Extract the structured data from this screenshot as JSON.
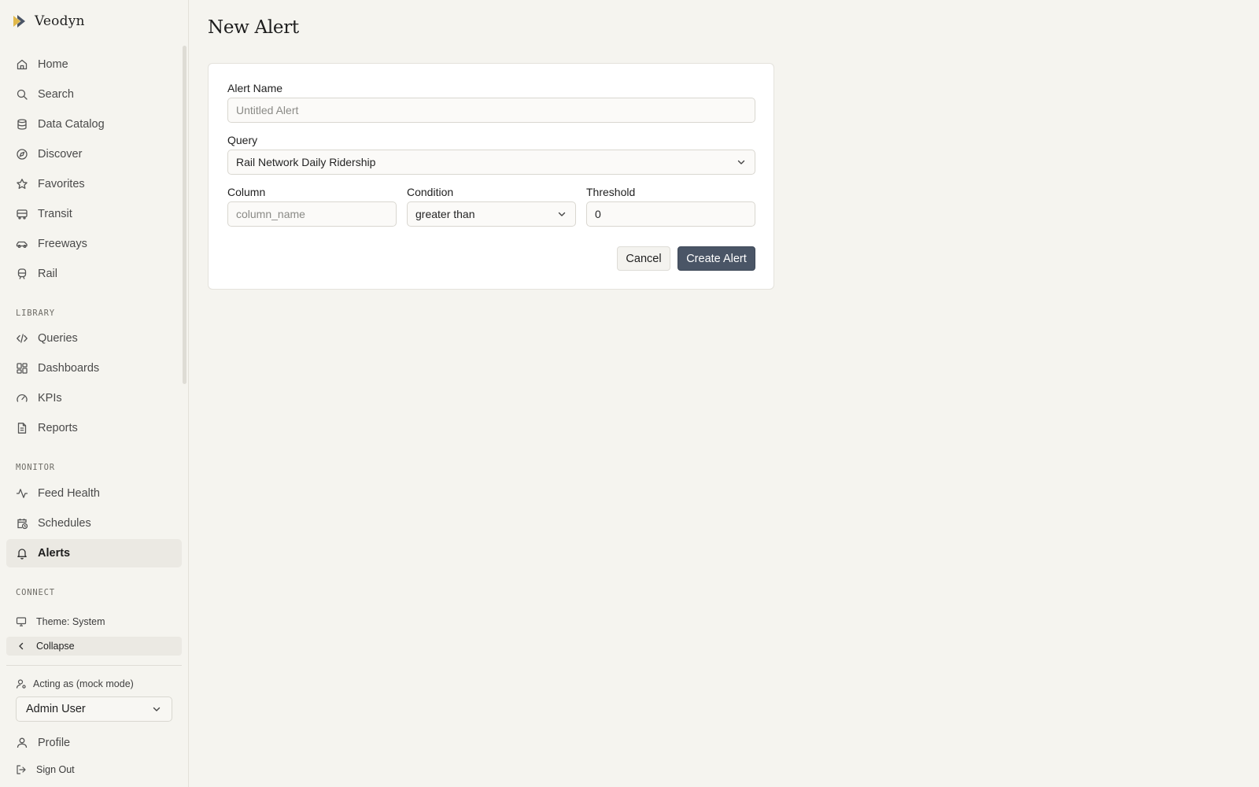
{
  "app": {
    "name": "Veodyn"
  },
  "sidebar": {
    "main_items": [
      {
        "label": "Home",
        "icon": "home-icon"
      },
      {
        "label": "Search",
        "icon": "search-icon"
      },
      {
        "label": "Data Catalog",
        "icon": "database-icon"
      },
      {
        "label": "Discover",
        "icon": "compass-icon"
      },
      {
        "label": "Favorites",
        "icon": "star-icon"
      },
      {
        "label": "Transit",
        "icon": "bus-icon"
      },
      {
        "label": "Freeways",
        "icon": "car-icon"
      },
      {
        "label": "Rail",
        "icon": "train-icon"
      }
    ],
    "library": {
      "label": "LIBRARY",
      "items": [
        {
          "label": "Queries",
          "icon": "code-icon"
        },
        {
          "label": "Dashboards",
          "icon": "dashboard-icon"
        },
        {
          "label": "KPIs",
          "icon": "gauge-icon"
        },
        {
          "label": "Reports",
          "icon": "report-icon"
        }
      ]
    },
    "monitor": {
      "label": "MONITOR",
      "items": [
        {
          "label": "Feed Health",
          "icon": "activity-icon"
        },
        {
          "label": "Schedules",
          "icon": "calendar-clock-icon"
        },
        {
          "label": "Alerts",
          "icon": "bell-icon",
          "active": true
        }
      ]
    },
    "connect": {
      "label": "CONNECT",
      "theme_label": "Theme: System",
      "collapse_label": "Collapse"
    },
    "acting_as_label": "Acting as (mock mode)",
    "acting_user": "Admin User",
    "profile_label": "Profile",
    "signout_label": "Sign Out"
  },
  "page": {
    "title": "New Alert",
    "form": {
      "alert_name": {
        "label": "Alert Name",
        "placeholder": "Untitled Alert",
        "value": ""
      },
      "query": {
        "label": "Query",
        "value": "Rail Network Daily Ridership"
      },
      "column": {
        "label": "Column",
        "placeholder": "column_name",
        "value": ""
      },
      "condition": {
        "label": "Condition",
        "value": "greater than"
      },
      "threshold": {
        "label": "Threshold",
        "value": "0"
      }
    },
    "buttons": {
      "cancel": "Cancel",
      "create": "Create Alert"
    }
  },
  "colors": {
    "background": "#f5f4ef",
    "primary_button": "#4a5566",
    "active_nav": "#ebe9e3",
    "logo_accent": "#e0b84a"
  }
}
